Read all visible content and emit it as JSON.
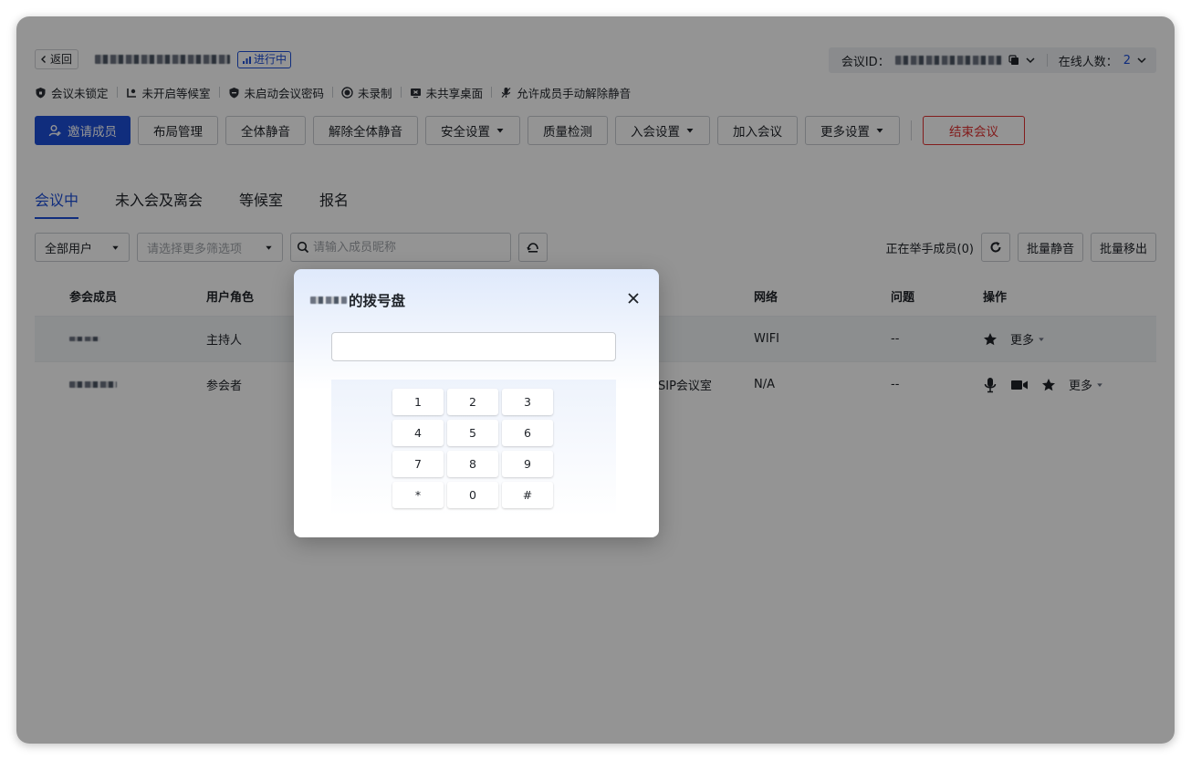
{
  "topbar": {
    "back_label": "返回",
    "status_label": "进行中",
    "meeting_id_label": "会议ID：",
    "online_label": "在线人数：",
    "online_count": "2"
  },
  "statusline": {
    "items": [
      "会议未锁定",
      "未开启等候室",
      "未启动会议密码",
      "未录制",
      "未共享桌面",
      "允许成员手动解除静音"
    ]
  },
  "toolbar": {
    "invite": "邀请成员",
    "layout": "布局管理",
    "mute_all": "全体静音",
    "unmute_all": "解除全体静音",
    "security": "安全设置",
    "quality": "质量检测",
    "join_settings": "入会设置",
    "join_meeting": "加入会议",
    "more_settings": "更多设置",
    "end_meeting": "结束会议"
  },
  "tabs": [
    "会议中",
    "未入会及离会",
    "等候室",
    "报名"
  ],
  "filters": {
    "user_filter": "全部用户",
    "more_filter_placeholder": "请选择更多筛选项",
    "search_placeholder": "请输入成员昵称",
    "raised_hands": "正在举手成员(0)",
    "batch_mute": "批量静音",
    "batch_remove": "批量移出"
  },
  "table": {
    "headers": {
      "member": "参会成员",
      "role": "用户角色",
      "network": "网络",
      "issue": "问题",
      "actions": "操作"
    },
    "rows": [
      {
        "role": "主持人",
        "device": "",
        "network": "WIFI",
        "issue": "--",
        "more": "更多"
      },
      {
        "role": "参会者",
        "device": "SIP会议室",
        "network": "N/A",
        "issue": "--",
        "more": "更多"
      }
    ]
  },
  "dialog": {
    "title_suffix": "的拨号盘",
    "input_value": "",
    "keys": [
      "1",
      "2",
      "3",
      "4",
      "5",
      "6",
      "7",
      "8",
      "9",
      "*",
      "0",
      "#"
    ]
  },
  "colors": {
    "accent": "#1d4ed8",
    "danger": "#e03131"
  }
}
